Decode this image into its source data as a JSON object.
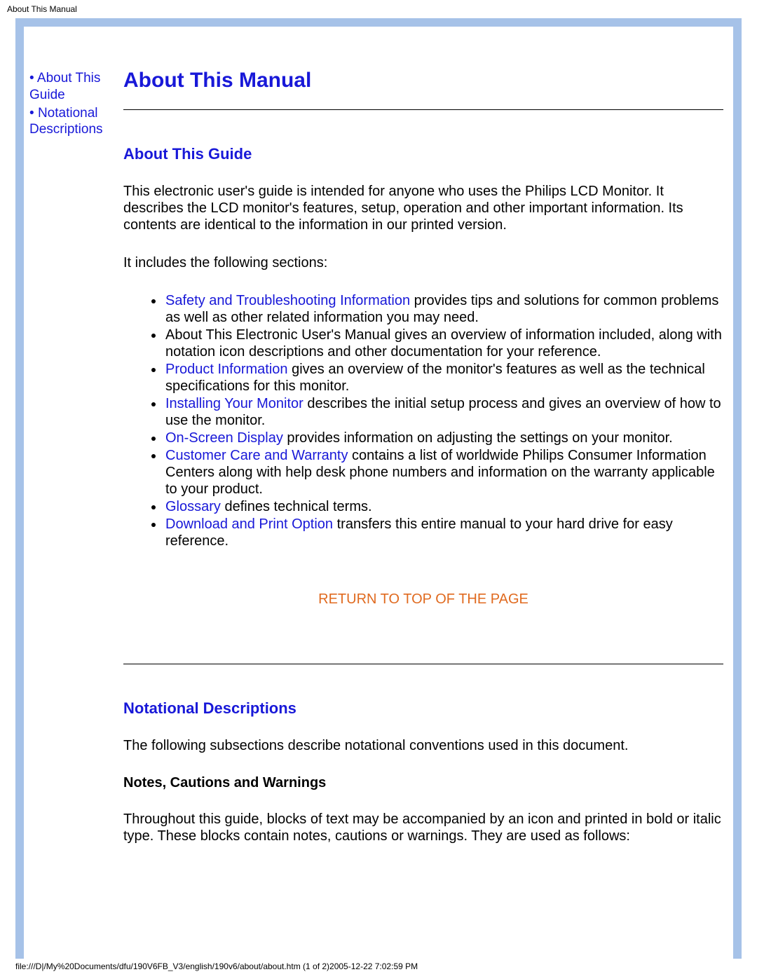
{
  "header_title": "About This Manual",
  "sidebar": {
    "items": [
      {
        "bullet": "•",
        "label": "About This Guide"
      },
      {
        "bullet": "•",
        "label": "Notational Descriptions"
      }
    ]
  },
  "main": {
    "title": "About This Manual",
    "section1": {
      "heading": "About This Guide",
      "para1": "This electronic user's guide is intended for anyone who uses the Philips LCD Monitor. It describes the LCD monitor's features, setup, operation and other important information. Its contents are identical to the information in our printed version.",
      "para2": "It includes the following sections:",
      "items": [
        {
          "link": "Safety and Troubleshooting Information",
          "rest": " provides tips and solutions for common problems as well as other related information you may need."
        },
        {
          "link": "",
          "rest": "About This Electronic User's Manual gives an overview of information included, along with notation icon descriptions and other documentation for your reference."
        },
        {
          "link": "Product Information",
          "rest": " gives an overview of the monitor's features as well as the technical specifications for this monitor."
        },
        {
          "link": "Installing Your Monitor",
          "rest": " describes the initial setup process and gives an overview of how to use the monitor."
        },
        {
          "link": "On-Screen Display",
          "rest": " provides information on adjusting the settings on your monitor."
        },
        {
          "link": "Customer Care and Warranty",
          "rest": " contains a list of worldwide Philips Consumer Information Centers along with help desk phone numbers and information on the warranty applicable to your product."
        },
        {
          "link": "Glossary",
          "rest": " defines technical terms."
        },
        {
          "link": "Download and Print Option",
          "rest": " transfers this entire manual to your hard drive for easy reference."
        }
      ],
      "return_label": "RETURN TO TOP OF THE PAGE"
    },
    "section2": {
      "heading": "Notational Descriptions",
      "para1": "The following subsections describe notational conventions used in this document.",
      "sub_heading": "Notes, Cautions and Warnings",
      "para2": "Throughout this guide, blocks of text may be accompanied by an icon and printed in bold or italic type. These blocks contain notes, cautions or warnings. They are used as follows:"
    }
  },
  "footer_path": "file:///D|/My%20Documents/dfu/190V6FB_V3/english/190v6/about/about.htm (1 of 2)2005-12-22 7:02:59 PM"
}
